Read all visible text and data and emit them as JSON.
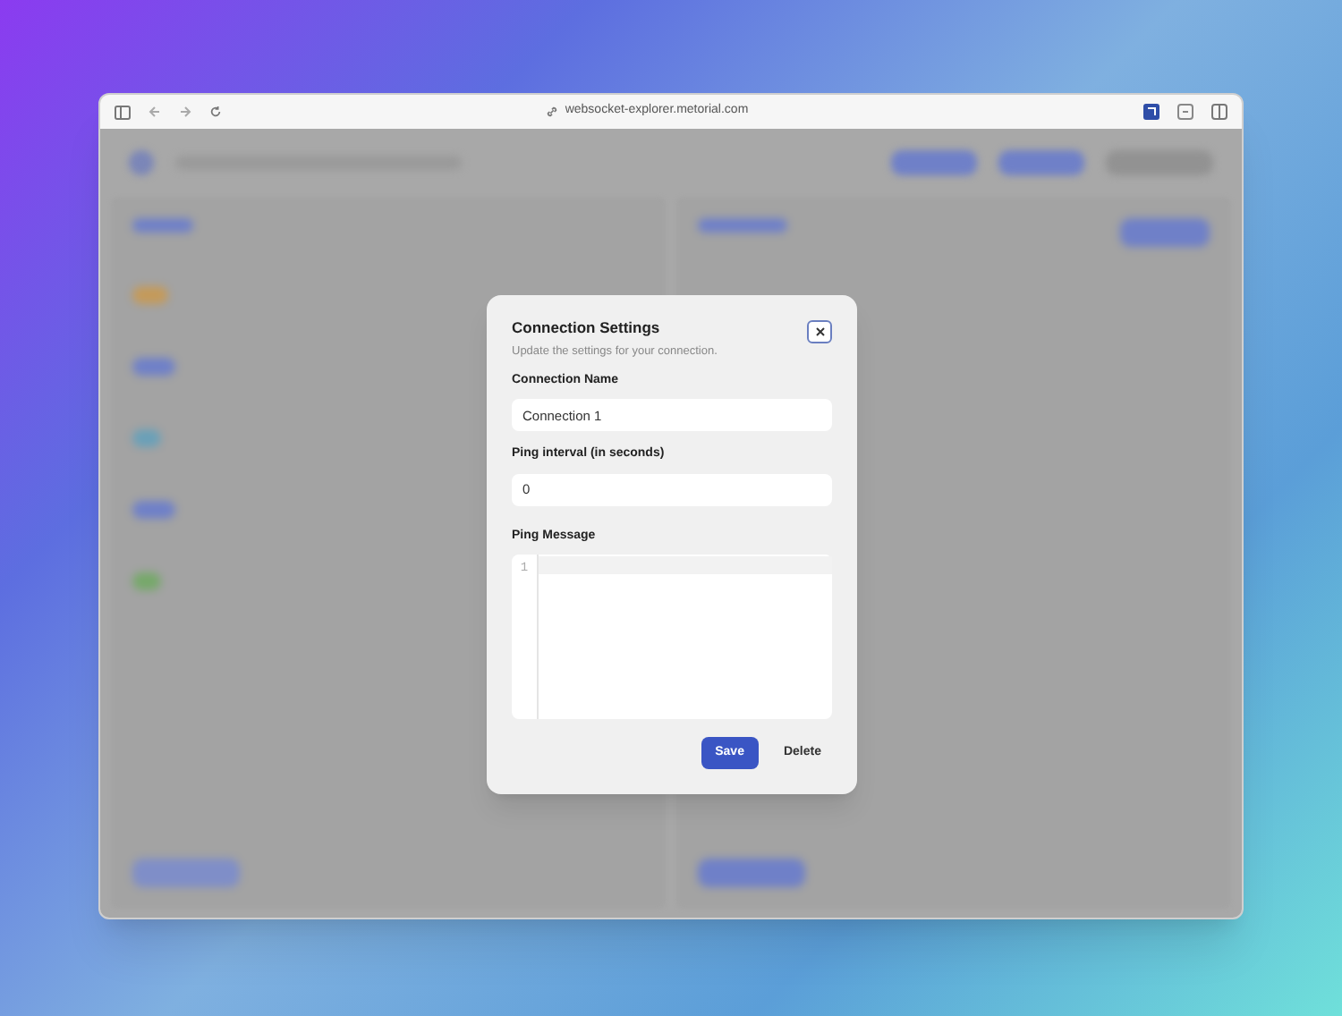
{
  "browser": {
    "url": "websocket-explorer.metorial.com"
  },
  "dialog": {
    "title": "Connection Settings",
    "subtitle": "Update the settings for your connection.",
    "fields": [
      {
        "kind": "text",
        "label": "Connection Name",
        "value": "Connection 1"
      },
      {
        "kind": "text",
        "label": "Ping interval (in seconds)",
        "value": "0"
      },
      {
        "kind": "code",
        "label": "Ping Message",
        "line_number": "1"
      }
    ],
    "buttons": [
      {
        "label": "Save",
        "kind": "primary"
      },
      {
        "label": "Delete",
        "kind": "plain"
      }
    ]
  }
}
